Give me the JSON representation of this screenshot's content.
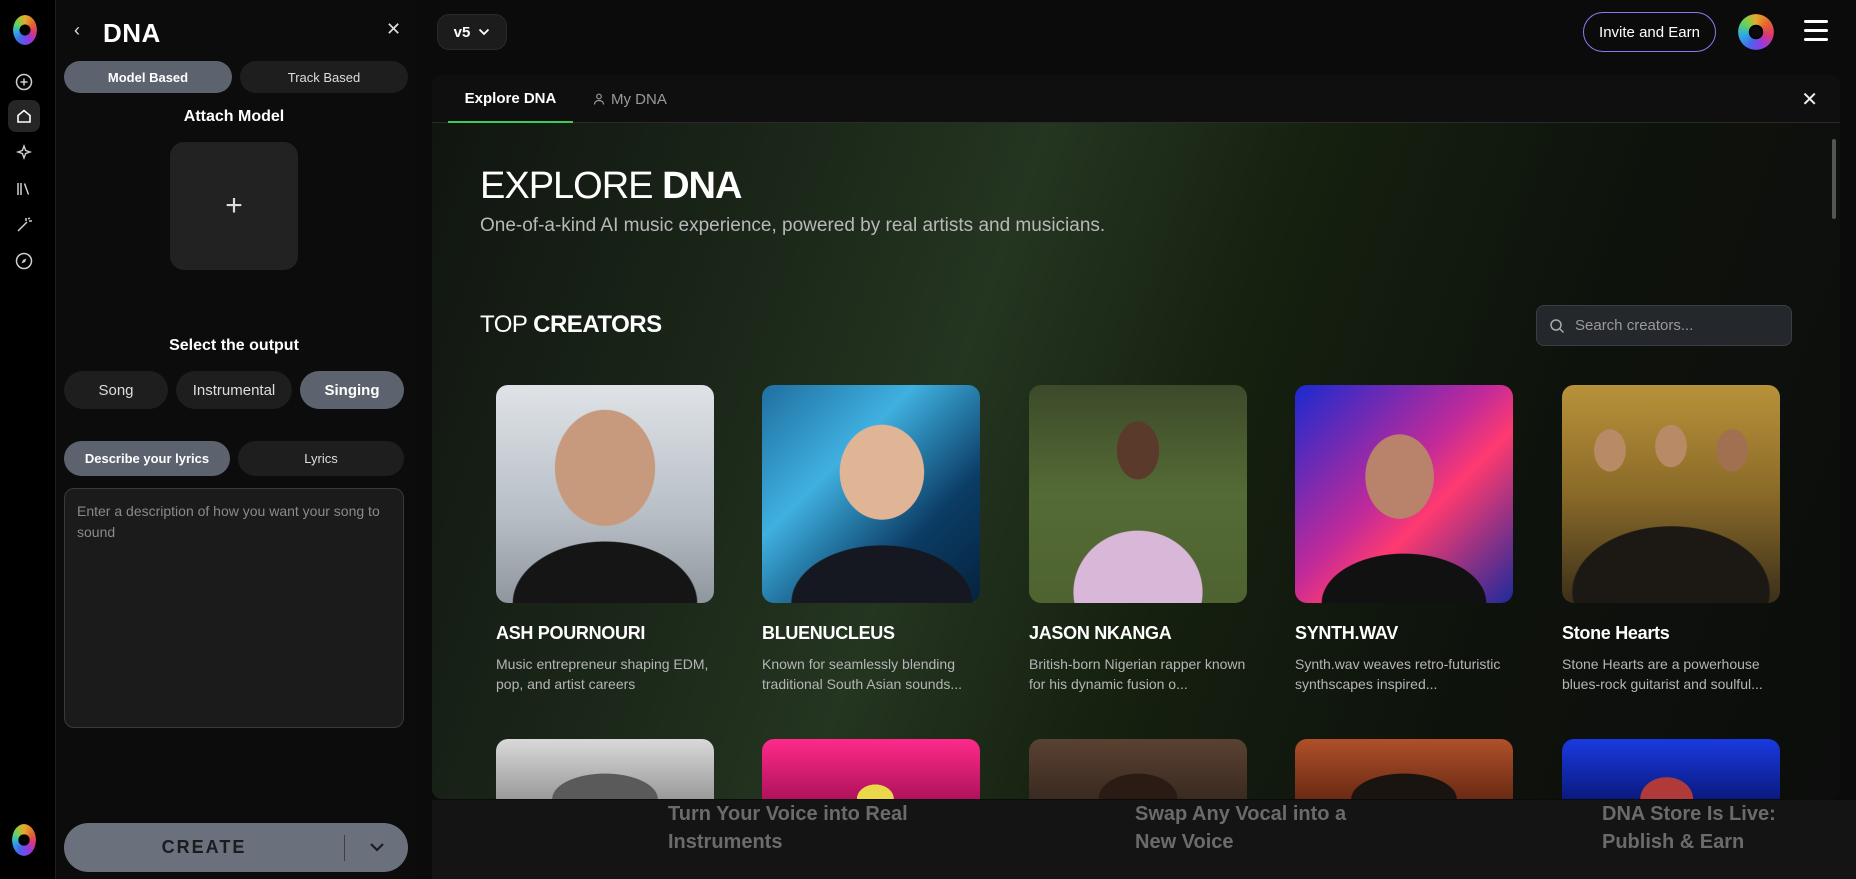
{
  "panel": {
    "title": "DNA",
    "mode_tabs": [
      "Model Based",
      "Track Based"
    ],
    "attach_label": "Attach Model",
    "attach_plus": "+",
    "output_label": "Select the output",
    "output_options": [
      "Song",
      "Instrumental",
      "Singing"
    ],
    "lyrics_tabs": [
      "Describe your lyrics",
      "Lyrics"
    ],
    "description_placeholder": "Enter a description of how you want your song to sound",
    "create_label": "CREATE"
  },
  "topbar": {
    "version": "v5",
    "invite_label": "Invite and Earn"
  },
  "modal": {
    "tabs": [
      "Explore DNA",
      "My DNA"
    ],
    "title_light": "EXPLORE",
    "title_bold": "DNA",
    "subtitle": "One-of-a-kind AI music experience, powered by real artists and musicians.",
    "section_light": "TOP",
    "section_bold": "CREATORS",
    "search_placeholder": "Search creators..."
  },
  "creators": [
    {
      "name": "ASH POURNOURI",
      "bio": "Music entrepreneur shaping EDM, pop, and artist careers"
    },
    {
      "name": "BLUENUCLEUS",
      "bio": "Known for seamlessly blending traditional South Asian sounds..."
    },
    {
      "name": "JASON NKANGA",
      "bio": "British-born Nigerian rapper known for his dynamic fusion o..."
    },
    {
      "name": "SYNTH.WAV",
      "bio": "Synth.wav weaves retro-futuristic synthscapes inspired..."
    },
    {
      "name": "Stone Hearts",
      "bio": "Stone Hearts are a powerhouse blues-rock guitarist and soulful..."
    }
  ],
  "promos": [
    "Turn Your Voice into Real Instruments",
    "Swap Any Vocal into a New Voice",
    "DNA Store Is Live: Publish & Earn"
  ],
  "icons": [
    "back-icon",
    "close-icon",
    "plus-icon",
    "chevron-down-icon",
    "search-icon",
    "user-icon",
    "menu-icon",
    "home-icon",
    "sparkle-icon",
    "library-icon",
    "wand-icon",
    "compass-icon",
    "add-circle-icon"
  ]
}
